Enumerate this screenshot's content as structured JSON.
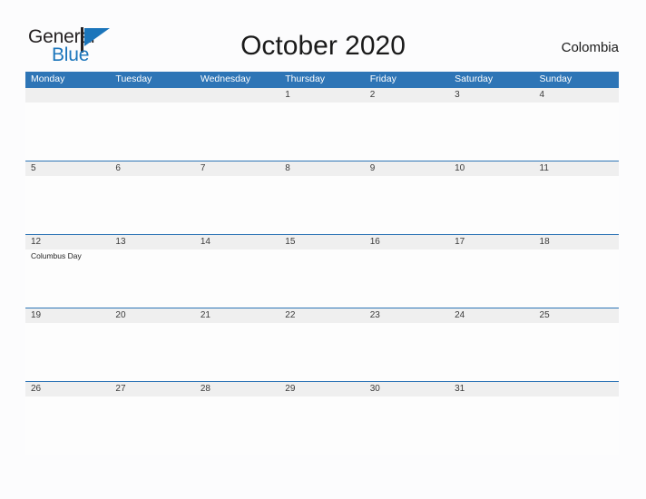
{
  "brand": {
    "name_part1": "General",
    "name_part2": "Blue",
    "flag_color": "#1b75bb",
    "text_color": "#231f20"
  },
  "header": {
    "title": "October 2020",
    "country": "Colombia"
  },
  "theme": {
    "header_blue": "#2E75B6",
    "date_band_gray": "#EFEFEF",
    "page_background": "#FCFCFD",
    "cell_background": "#FDFDFD"
  },
  "calendar": {
    "weekdays": [
      "Monday",
      "Tuesday",
      "Wednesday",
      "Thursday",
      "Friday",
      "Saturday",
      "Sunday"
    ],
    "weeks": [
      {
        "days": [
          {
            "date": "",
            "event": ""
          },
          {
            "date": "",
            "event": ""
          },
          {
            "date": "",
            "event": ""
          },
          {
            "date": "1",
            "event": ""
          },
          {
            "date": "2",
            "event": ""
          },
          {
            "date": "3",
            "event": ""
          },
          {
            "date": "4",
            "event": ""
          }
        ]
      },
      {
        "days": [
          {
            "date": "5",
            "event": ""
          },
          {
            "date": "6",
            "event": ""
          },
          {
            "date": "7",
            "event": ""
          },
          {
            "date": "8",
            "event": ""
          },
          {
            "date": "9",
            "event": ""
          },
          {
            "date": "10",
            "event": ""
          },
          {
            "date": "11",
            "event": ""
          }
        ]
      },
      {
        "days": [
          {
            "date": "12",
            "event": "Columbus Day"
          },
          {
            "date": "13",
            "event": ""
          },
          {
            "date": "14",
            "event": ""
          },
          {
            "date": "15",
            "event": ""
          },
          {
            "date": "16",
            "event": ""
          },
          {
            "date": "17",
            "event": ""
          },
          {
            "date": "18",
            "event": ""
          }
        ]
      },
      {
        "days": [
          {
            "date": "19",
            "event": ""
          },
          {
            "date": "20",
            "event": ""
          },
          {
            "date": "21",
            "event": ""
          },
          {
            "date": "22",
            "event": ""
          },
          {
            "date": "23",
            "event": ""
          },
          {
            "date": "24",
            "event": ""
          },
          {
            "date": "25",
            "event": ""
          }
        ]
      },
      {
        "days": [
          {
            "date": "26",
            "event": ""
          },
          {
            "date": "27",
            "event": ""
          },
          {
            "date": "28",
            "event": ""
          },
          {
            "date": "29",
            "event": ""
          },
          {
            "date": "30",
            "event": ""
          },
          {
            "date": "31",
            "event": ""
          },
          {
            "date": "",
            "event": ""
          }
        ]
      }
    ]
  }
}
